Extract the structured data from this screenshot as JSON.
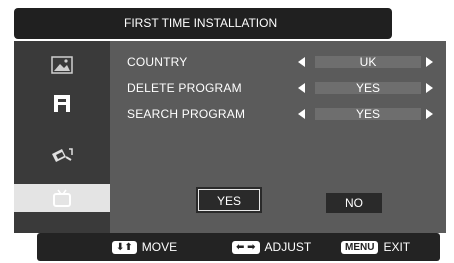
{
  "title": "FIRST TIME INSTALLATION",
  "sidebar": {
    "items": [
      {
        "icon": "picture-icon"
      },
      {
        "icon": "channel-icon"
      },
      {
        "icon": "settings-icon"
      },
      {
        "icon": "tv-icon",
        "active": true
      }
    ]
  },
  "menu": {
    "rows": [
      {
        "label": "COUNTRY",
        "value": "UK"
      },
      {
        "label": "DELETE PROGRAM",
        "value": "YES"
      },
      {
        "label": "SEARCH PROGRAM",
        "value": "YES"
      }
    ]
  },
  "buttons": {
    "yes_label": "YES",
    "no_label": "NO"
  },
  "footer": {
    "move_key": "⬇⬆",
    "move_label": "MOVE",
    "adjust_key": "⬅ ➡",
    "adjust_label": "ADJUST",
    "menu_key": "MENU",
    "exit_label": "EXIT"
  },
  "colors": {
    "panel": "#5b5b5b",
    "sidebar": "#3a3a3a",
    "title_bar": "#202020",
    "value_box": "#6e6e6e",
    "footer": "#232323"
  }
}
